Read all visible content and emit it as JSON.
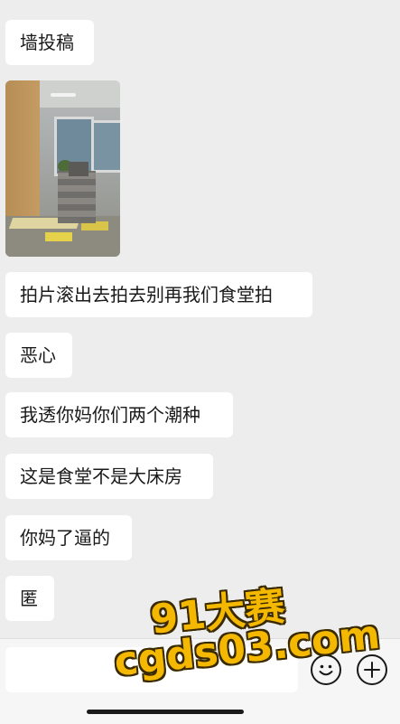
{
  "chat": {
    "messages": [
      {
        "text": "墙投稿"
      },
      {
        "image": "canteen-photo"
      },
      {
        "text": "拍片滚出去拍去别再我们食堂拍"
      },
      {
        "text": "恶心"
      },
      {
        "text": "我透你妈你们两个潮种"
      },
      {
        "text": "这是食堂不是大床房"
      },
      {
        "text": "你妈了逼的"
      },
      {
        "text": "匿"
      }
    ]
  },
  "input": {
    "placeholder": "",
    "emoji_icon": "emoji-icon",
    "plus_icon": "plus-icon"
  },
  "watermark": {
    "line1": "91大赛",
    "line2": "cgds03.com",
    "color": "#f5b800"
  }
}
